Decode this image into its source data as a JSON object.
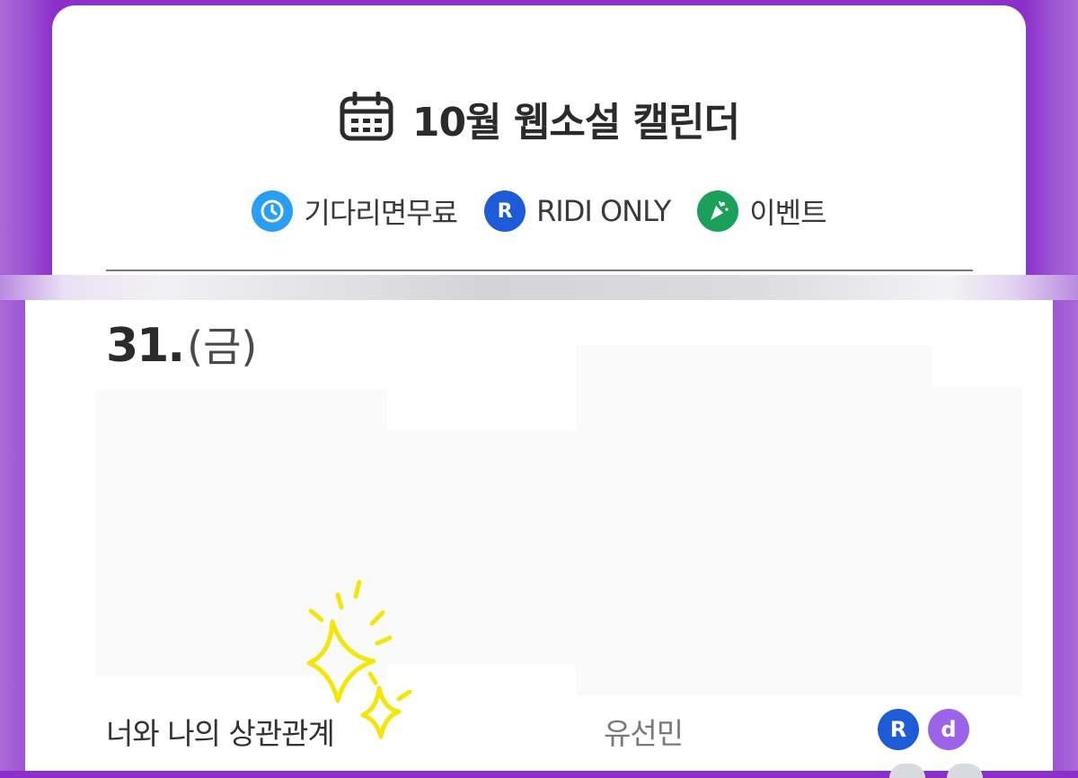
{
  "header": {
    "title": "10월 웹소설 캘린더",
    "calendar_icon": "calendar-icon"
  },
  "legend": {
    "items": [
      {
        "label": "기다리면무료",
        "icon": "clock-icon",
        "color": "#2a9df4"
      },
      {
        "label": "RIDI ONLY",
        "icon": "ridi-r-icon",
        "glyph": "R",
        "color": "#1e5bd6"
      },
      {
        "label": "이벤트",
        "icon": "party-popper-icon",
        "color": "#1aa05a"
      }
    ]
  },
  "day": {
    "date": "31.",
    "weekday": "(금)"
  },
  "book": {
    "title": "너와 나의 상관관계",
    "author": "유선민",
    "platforms": [
      {
        "glyph": "R",
        "icon": "ridi-r-icon",
        "color": "#1e5bd6"
      },
      {
        "glyph": "d",
        "icon": "d-platform-icon",
        "color": "#9a63e8"
      }
    ]
  },
  "colors": {
    "background": "#8a2fc8",
    "sparkle": "#ffe800"
  }
}
